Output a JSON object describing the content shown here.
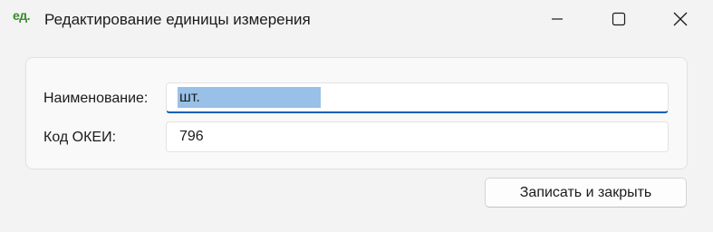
{
  "window": {
    "app_icon_text": "ед.",
    "title": "Редактирование единицы измерения",
    "controls": [
      "minimize-icon",
      "maximize-icon",
      "close-icon"
    ]
  },
  "form": {
    "name_label": "Наименование:",
    "name_value": "шт.",
    "code_label": "Код ОКЕИ:",
    "code_value": "796"
  },
  "actions": {
    "save_close_label": "Записать и закрыть"
  },
  "colors": {
    "accent": "#005fb8",
    "selection": "#99c0e6",
    "icon_green": "#3a8a2a"
  }
}
